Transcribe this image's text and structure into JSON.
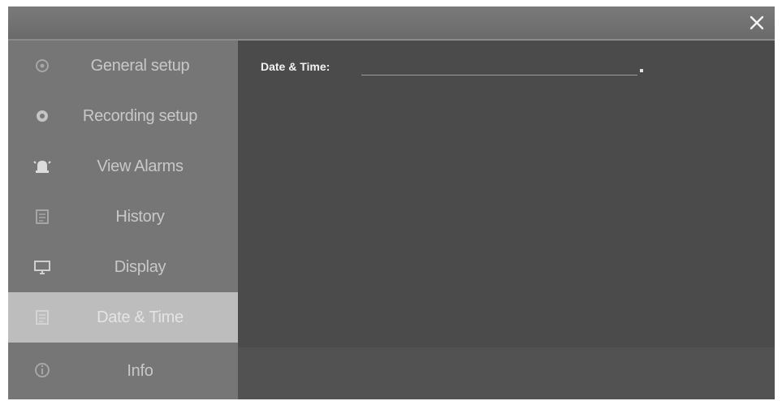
{
  "window": {
    "close_icon": "close-icon"
  },
  "sidebar": {
    "items": [
      {
        "label": "General setup",
        "icon": "gear-icon",
        "active": false
      },
      {
        "label": "Recording setup",
        "icon": "record-icon",
        "active": false
      },
      {
        "label": "View Alarms",
        "icon": "bell-icon",
        "active": false
      },
      {
        "label": "History",
        "icon": "calendar-icon",
        "active": false
      },
      {
        "label": "Display",
        "icon": "monitor-icon",
        "active": false
      },
      {
        "label": "Date & Time",
        "icon": "calendar-icon",
        "active": true
      },
      {
        "label": "Info",
        "icon": "info-icon",
        "active": false
      }
    ]
  },
  "main": {
    "date_time_label": "Date & Time:",
    "date_time_value": ""
  },
  "colors": {
    "sidebar_bg": "#767676",
    "sidebar_active_bg": "#bdbdbd",
    "content_bg": "#4b4b4b",
    "titlebar_bg": "#707070"
  }
}
